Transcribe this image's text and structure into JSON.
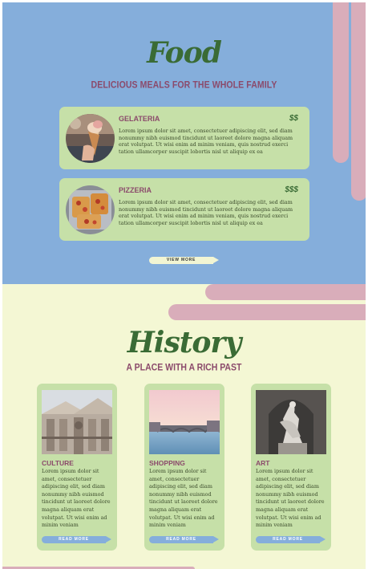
{
  "colors": {
    "blue_bg": "#85aedb",
    "cream_bg": "#f4f7d4",
    "card_green": "#c6e0a8",
    "accent_pink": "#d9adba",
    "title_green": "#3a6b35",
    "label_plum": "#8b4a6b"
  },
  "food": {
    "title": "Food",
    "subtitle": "DELICIOUS MEALS FOR THE WHOLE FAMILY",
    "items": [
      {
        "name": "GELATERIA",
        "price": "$$",
        "image": "gelato-cone-photo",
        "description": "Lorem ipsum dolor sit amet, consectetuer adipiscing elit, sed diam nonummy nibh euismod tincidunt ut laoreet dolore magna aliquam erat volutpat. Ut wisi enim ad minim veniam, quis nostrud exerci tation ullamcorper suscipit lobortis nisl ut aliquip ex ea"
      },
      {
        "name": "PIZZERIA",
        "price": "$$$",
        "image": "pizza-tray-photo",
        "description": "Lorem ipsum dolor sit amet, consectetuer adipiscing elit, sed diam nonummy nibh euismod tincidunt ut laoreet dolore magna aliquam erat volutpat. Ut wisi enim ad minim veniam, quis nostrud exerci tation ullamcorper suscipit lobortis nisl ut aliquip ex ea"
      }
    ],
    "view_more_label": "VIEW MORE"
  },
  "history": {
    "title": "History",
    "subtitle": "A PLACE WITH A RICH PAST",
    "items": [
      {
        "name": "CULTURE",
        "image": "cathedral-facade-photo",
        "description": "Lorem ipsum dolor sit amet, consectetuer adipiscing elit, sed diam nonummy nibh euismod tincidunt ut laoreet dolore magna aliquam erat volutpat. Ut wisi enim ad minim veniam",
        "button_label": "READ MORE"
      },
      {
        "name": "SHOPPING",
        "image": "river-bridge-sunset-photo",
        "description": "Lorem ipsum dolor sit amet, consectetuer adipiscing elit, sed diam nonummy nibh euismod tincidunt ut laoreet dolore magna aliquam erat volutpat. Ut wisi enim ad minim veniam",
        "button_label": "READ MORE"
      },
      {
        "name": "ART",
        "image": "marble-statue-photo",
        "description": "Lorem ipsum dolor sit amet, consectetuer adipiscing elit, sed diam nonummy nibh euismod tincidunt ut laoreet dolore magna aliquam erat volutpat. Ut wisi enim ad minim veniam",
        "button_label": "READ MORE"
      }
    ]
  }
}
